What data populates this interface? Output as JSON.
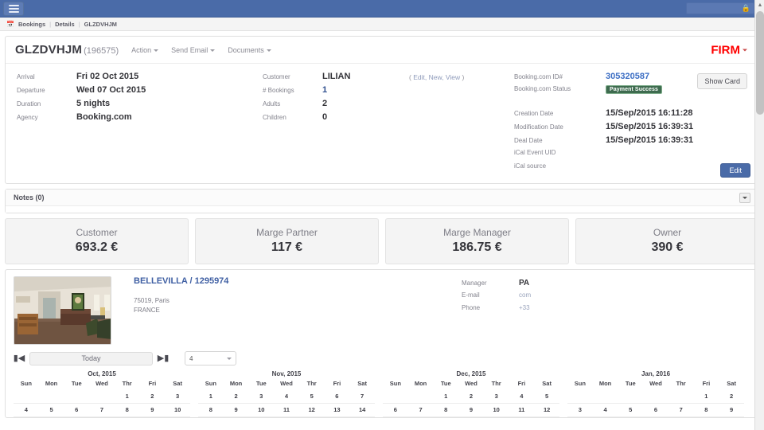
{
  "navbar": {
    "menu_icon": "hamburger-icon",
    "lock_icon": "lock-icon",
    "lock_glyph": "🔒"
  },
  "breadcrumb": {
    "icon": "calendar-icon",
    "items": [
      "Bookings",
      "Details",
      "GLZDVHJM"
    ],
    "separator": "|"
  },
  "booking": {
    "reference": "GLZDVHJM",
    "id_paren": "(196575)",
    "menus": [
      {
        "label": "Action"
      },
      {
        "label": "Send Email"
      },
      {
        "label": "Documents"
      }
    ],
    "status_label": "FIRM",
    "stay": {
      "arrival_label": "Arrival",
      "arrival_value": "Fri 02 Oct 2015",
      "departure_label": "Departure",
      "departure_value": "Wed 07 Oct 2015",
      "duration_label": "Duration",
      "duration_value": "5 nights",
      "agency_label": "Agency",
      "agency_value": "Booking.com"
    },
    "customer": {
      "customer_label": "Customer",
      "customer_value": "LILIAN",
      "bookings_label": "# Bookings",
      "bookings_value": "1",
      "adults_label": "Adults",
      "adults_value": "2",
      "children_label": "Children",
      "children_value": "0",
      "actions_open": "(",
      "actions_close": ")",
      "action_edit": "Edit,",
      "action_new": "New,",
      "action_view": "View"
    },
    "channel": {
      "booking_id_label": "Booking.com ID#",
      "booking_id_value": "305320587",
      "status_label": "Booking.com Status",
      "status_value": "Payment Success",
      "creation_label": "Creation Date",
      "creation_value": "15/Sep/2015 16:11:28",
      "modification_label": "Modification Date",
      "modification_value": "15/Sep/2015 16:39:31",
      "deal_label": "Deal Date",
      "deal_value": "15/Sep/2015 16:39:31",
      "ical_uid_label": "iCal Event UID",
      "ical_uid_value": "",
      "ical_source_label": "iCal source",
      "ical_source_value": "",
      "show_card_label": "Show Card"
    },
    "edit_label": "Edit"
  },
  "notes": {
    "title": "Notes (0)",
    "collapse_icon": "chevron-down-icon"
  },
  "metrics": [
    {
      "label": "Customer",
      "value": "693.2 €"
    },
    {
      "label": "Marge Partner",
      "value": "117 €"
    },
    {
      "label": "Marge Manager",
      "value": "186.75 €"
    },
    {
      "label": "Owner",
      "value": "390 €"
    }
  ],
  "property": {
    "thumbnail_alt": "property-interior-photo",
    "title": "BELLEVILLA / 1295974",
    "address_line1": "75019, Paris",
    "address_line2": "FRANCE",
    "manager_label": "Manager",
    "manager_value": "PA",
    "email_label": "E-mail",
    "email_value": "com",
    "phone_label": "Phone",
    "phone_value": "+33"
  },
  "calendar": {
    "prev_icon": "skip-previous-icon",
    "next_icon": "skip-next-icon",
    "today_label": "Today",
    "months_count": "4",
    "weekdays": [
      "Sun",
      "Mon",
      "Tue",
      "Wed",
      "Thr",
      "Fri",
      "Sat"
    ],
    "months": [
      {
        "name": "Oct, 2015",
        "weeks": [
          [
            {
              "t": "",
              "s": "empty"
            },
            {
              "t": "",
              "s": "empty"
            },
            {
              "t": "",
              "s": "empty"
            },
            {
              "t": "",
              "s": "empty"
            },
            {
              "t": "1",
              "s": ""
            },
            {
              "t": "2",
              "s": "half-start"
            },
            {
              "t": "3",
              "s": "booked"
            }
          ],
          [
            {
              "t": "4",
              "s": "booked"
            },
            {
              "t": "5",
              "s": "booked"
            },
            {
              "t": "6",
              "s": "booked"
            },
            {
              "t": "7",
              "s": "half-end"
            },
            {
              "t": "8",
              "s": ""
            },
            {
              "t": "9",
              "s": ""
            },
            {
              "t": "10",
              "s": ""
            }
          ]
        ]
      },
      {
        "name": "Nov, 2015",
        "weeks": [
          [
            {
              "t": "1",
              "s": ""
            },
            {
              "t": "2",
              "s": ""
            },
            {
              "t": "3",
              "s": ""
            },
            {
              "t": "4",
              "s": ""
            },
            {
              "t": "5",
              "s": ""
            },
            {
              "t": "6",
              "s": ""
            },
            {
              "t": "7",
              "s": ""
            }
          ],
          [
            {
              "t": "8",
              "s": ""
            },
            {
              "t": "9",
              "s": ""
            },
            {
              "t": "10",
              "s": ""
            },
            {
              "t": "11",
              "s": ""
            },
            {
              "t": "12",
              "s": ""
            },
            {
              "t": "13",
              "s": ""
            },
            {
              "t": "14",
              "s": ""
            }
          ]
        ]
      },
      {
        "name": "Dec, 2015",
        "weeks": [
          [
            {
              "t": "",
              "s": "empty"
            },
            {
              "t": "",
              "s": "empty"
            },
            {
              "t": "1",
              "s": ""
            },
            {
              "t": "2",
              "s": ""
            },
            {
              "t": "3",
              "s": ""
            },
            {
              "t": "4",
              "s": ""
            },
            {
              "t": "5",
              "s": ""
            }
          ],
          [
            {
              "t": "6",
              "s": ""
            },
            {
              "t": "7",
              "s": ""
            },
            {
              "t": "8",
              "s": ""
            },
            {
              "t": "9",
              "s": ""
            },
            {
              "t": "10",
              "s": ""
            },
            {
              "t": "11",
              "s": ""
            },
            {
              "t": "12",
              "s": ""
            }
          ]
        ]
      },
      {
        "name": "Jan, 2016",
        "weeks": [
          [
            {
              "t": "",
              "s": "empty"
            },
            {
              "t": "",
              "s": "empty"
            },
            {
              "t": "",
              "s": "empty"
            },
            {
              "t": "",
              "s": "empty"
            },
            {
              "t": "",
              "s": "empty"
            },
            {
              "t": "1",
              "s": ""
            },
            {
              "t": "2",
              "s": ""
            }
          ],
          [
            {
              "t": "3",
              "s": ""
            },
            {
              "t": "4",
              "s": ""
            },
            {
              "t": "5",
              "s": ""
            },
            {
              "t": "6",
              "s": ""
            },
            {
              "t": "7",
              "s": ""
            },
            {
              "t": "8",
              "s": ""
            },
            {
              "t": "9",
              "s": ""
            }
          ]
        ]
      }
    ]
  },
  "colors": {
    "navbar": "#4a6ba8",
    "accent_blue": "#3c6ec4",
    "status_red": "#ff0000",
    "booked_red": "#fb0000",
    "badge_green": "#3e6b4f"
  }
}
